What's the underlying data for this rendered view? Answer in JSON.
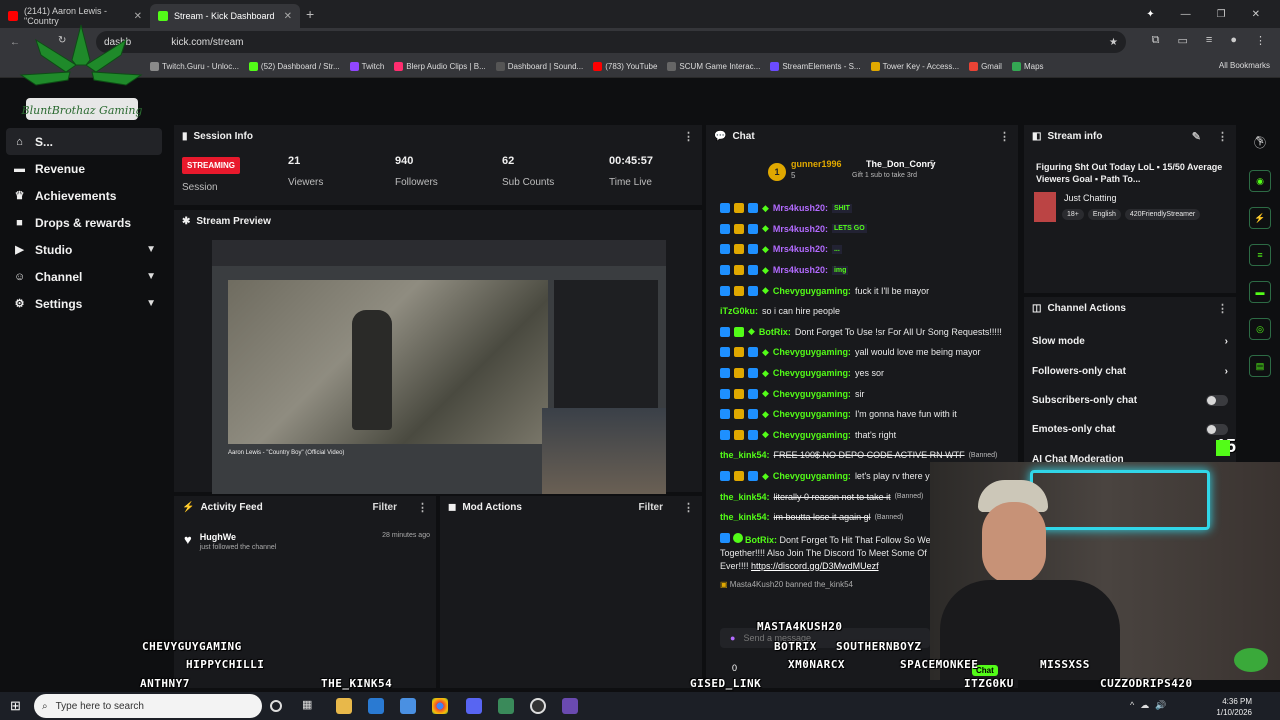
{
  "browser": {
    "tabs": [
      {
        "label": "(2141) Aaron Lewis - \"Country",
        "active": false
      },
      {
        "label": "Stream - Kick Dashboard",
        "active": true
      }
    ],
    "new_tab": "+",
    "url_prefix": "dashb",
    "url_suffix": "kick.com/stream",
    "bookmarks": [
      "Twitch.Guru - Unloc...",
      "(52) Dashboard / Str...",
      "Twitch",
      "Blerp Audio Clips | B...",
      "Dashboard | Sound...",
      "(783) YouTube",
      "SCUM Game Interac...",
      "StreamElements - S...",
      "Tower Key - Access...",
      "Gmail",
      "Maps"
    ],
    "all_bookmarks": "All Bookmarks",
    "logo_text": "BluntBrothaz Gaming"
  },
  "sidebar": {
    "items": [
      {
        "label": "S...",
        "icon": "home-icon",
        "chevron": false,
        "active": true
      },
      {
        "label": "Revenue",
        "icon": "revenue-icon",
        "chevron": false
      },
      {
        "label": "Achievements",
        "icon": "trophy-icon",
        "chevron": false
      },
      {
        "label": "Drops & rewards",
        "icon": "gift-icon",
        "chevron": false
      },
      {
        "label": "Studio",
        "icon": "play-icon",
        "chevron": true
      },
      {
        "label": "Channel",
        "icon": "user-icon",
        "chevron": true
      },
      {
        "label": "Settings",
        "icon": "gear-icon",
        "chevron": true
      }
    ]
  },
  "session": {
    "title": "Session Info",
    "status": "STREAMING",
    "status_label": "Session",
    "stats": [
      {
        "value": "21",
        "label": "Viewers"
      },
      {
        "value": "940",
        "label": "Followers"
      },
      {
        "value": "62",
        "label": "Sub Counts"
      },
      {
        "value": "00:45:57",
        "label": "Time Live"
      }
    ]
  },
  "preview": {
    "title": "Stream Preview",
    "video_title": "Aaron Lewis - \"Country Boy\" (Official Video)"
  },
  "activity": {
    "title": "Activity Feed",
    "filter": "Filter",
    "items": [
      {
        "user": "HughWe",
        "text": "just followed the channel",
        "time": "28 minutes ago"
      }
    ]
  },
  "mod_actions": {
    "title": "Mod Actions",
    "filter": "Filter"
  },
  "chat": {
    "title": "Chat",
    "pinned": {
      "user1": "gunner1996",
      "user2": "The_Don_Conry",
      "count1": "5",
      "count2": "5",
      "gift_text": "Gift 1 sub to take 3rd",
      "rank": "1"
    },
    "messages": [
      {
        "user": "Mrs4kush20:",
        "text": "",
        "color": "#b36bff",
        "emote": "SHIT"
      },
      {
        "user": "Mrs4kush20:",
        "text": "",
        "color": "#b36bff",
        "emote": "LETS GO"
      },
      {
        "user": "Mrs4kush20:",
        "text": "",
        "color": "#b36bff",
        "emote": "..."
      },
      {
        "user": "Mrs4kush20:",
        "text": "",
        "color": "#b36bff",
        "emote": "img"
      },
      {
        "user": "Chevyguygaming:",
        "text": "fuck it I'll be mayor",
        "color": "#53fc18"
      },
      {
        "user": "iTzG0ku:",
        "text": "so i can hire people",
        "color": "#53fc18"
      },
      {
        "user": "BotRix:",
        "text": "Dont Forget To Use !sr For All Ur Song Requests!!!!!",
        "color": "#53fc18"
      },
      {
        "user": "Chevyguygaming:",
        "text": "yall would love me being mayor",
        "color": "#53fc18"
      },
      {
        "user": "Chevyguygaming:",
        "text": "yes sor",
        "color": "#53fc18"
      },
      {
        "user": "Chevyguygaming:",
        "text": "sir",
        "color": "#53fc18"
      },
      {
        "user": "Chevyguygaming:",
        "text": "I'm gonna have fun with it",
        "color": "#53fc18"
      },
      {
        "user": "Chevyguygaming:",
        "text": "that's right",
        "color": "#53fc18"
      },
      {
        "user": "the_kink54:",
        "text": "FREE 100$ NO DEPO CODE ACTIVE RN WTF",
        "color": "#53fc18",
        "banned": "(Banned)"
      },
      {
        "user": "Chevyguygaming:",
        "text": "let's play rv there y",
        "color": "#53fc18"
      },
      {
        "user": "the_kink54:",
        "text": "literally 0 reason not to take it",
        "color": "#53fc18",
        "banned": "(Banned)"
      },
      {
        "user": "the_kink54:",
        "text": "im boutta lose it again gl",
        "color": "#53fc18",
        "banned": "(Banned)"
      }
    ],
    "botrix_last": {
      "user": "BotRix:",
      "line1": "Dont Forget To Hit That Follow So We",
      "line2": "Together!!!! Also Join The Discord To Meet Some Of",
      "line3_pre": "Ever!!!!",
      "link": "https://discord.gg/D3MwdMUezf"
    },
    "system": "Masta4Kush20 banned the_kink54",
    "send_placeholder": "Send a message",
    "chat_button": "Chat",
    "count": "0"
  },
  "stream_info": {
    "title": "Stream info",
    "stream_title": "Figuring Sht Out Today LoL ▪ 15/50 Average Viewers Goal ▪ Path To...",
    "category": "Just Chatting",
    "tags": [
      "18+",
      "English",
      "420FriendlyStreamer"
    ]
  },
  "channel_actions": {
    "title": "Channel Actions",
    "rows": [
      {
        "label": "Slow mode",
        "control": "chevron"
      },
      {
        "label": "Followers-only chat",
        "control": "chevron"
      },
      {
        "label": "Subscribers-only chat",
        "control": "toggle"
      },
      {
        "label": "Emotes-only chat",
        "control": "toggle"
      },
      {
        "label": "AI Chat Moderation",
        "control": "none"
      }
    ]
  },
  "rail_count": "15",
  "overlay_names": [
    "CHEVYGUYGAMING",
    "HIPPYCHILLI",
    "ANTHNY7",
    "THE_KINK54",
    "GISED_LINK",
    "MASTA4KUSH20",
    "BOTRIX",
    "SOUTHERNBOYZ",
    "XM0NARCX",
    "SPACEMONKEE",
    "MISSXSS",
    "ITZG0KU",
    "CUZZODRIPS420"
  ],
  "taskbar": {
    "search_placeholder": "Type here to search",
    "time": "4:36 PM",
    "date": "1/10/2026"
  },
  "colors": {
    "kick_green": "#53fc18",
    "live_red": "#e8192c",
    "panel_bg": "#18191c",
    "page_bg": "#0e0f11"
  }
}
